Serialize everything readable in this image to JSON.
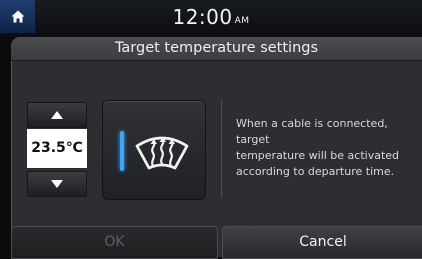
{
  "status_bar": {
    "time": "12:00",
    "ampm": "AM",
    "home_icon": "home-icon"
  },
  "dialog": {
    "title": "Target temperature settings",
    "temperature": {
      "value": "23.5℃",
      "up_icon": "triangle-up-icon",
      "down_icon": "triangle-down-icon"
    },
    "defrost": {
      "icon": "rear-defroster-icon",
      "indicator_color": "#3aa6ff"
    },
    "info_lines": [
      "When a cable is connected,",
      "target",
      "temperature will be activated",
      "according to departure time."
    ],
    "buttons": {
      "ok": "OK",
      "cancel": "Cancel"
    }
  }
}
